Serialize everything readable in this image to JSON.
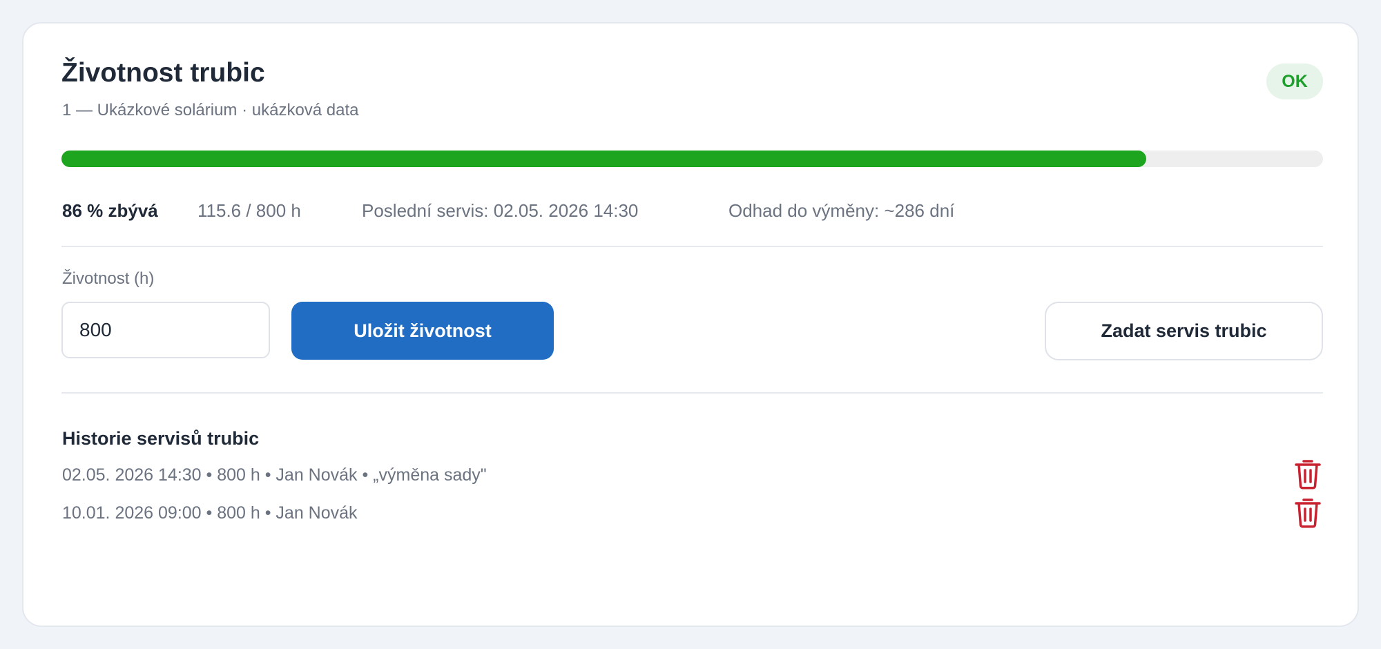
{
  "card": {
    "title": "Životnost trubic",
    "subtitle": "1 — Ukázkové solárium · ukázková data",
    "status_badge": "OK"
  },
  "progress": {
    "fraction": 0.86,
    "color": "#1ea51f"
  },
  "stats": {
    "remaining": "86 % zbývá",
    "hours": "115.6 / 800 h",
    "last_service": "Poslední servis: 02.05. 2026 14:30",
    "estimate": "Odhad do výměny: ~286 dní"
  },
  "form": {
    "lifetime_label": "Životnost (h)",
    "lifetime_value": "800",
    "save_label": "Uložit životnost",
    "service_label": "Zadat servis trubic"
  },
  "history": {
    "title": "Historie servisů trubic",
    "items": [
      {
        "text": "02.05. 2026 14:30 • 800 h • Jan Novák • „výměna sady\"",
        "icon": "trash-icon"
      },
      {
        "text": "10.01. 2026 09:00 • 800 h • Jan Novák",
        "icon": "trash-icon"
      }
    ]
  },
  "colors": {
    "primary": "#216dc4",
    "success": "#1ea51f",
    "danger": "#c8212f"
  }
}
